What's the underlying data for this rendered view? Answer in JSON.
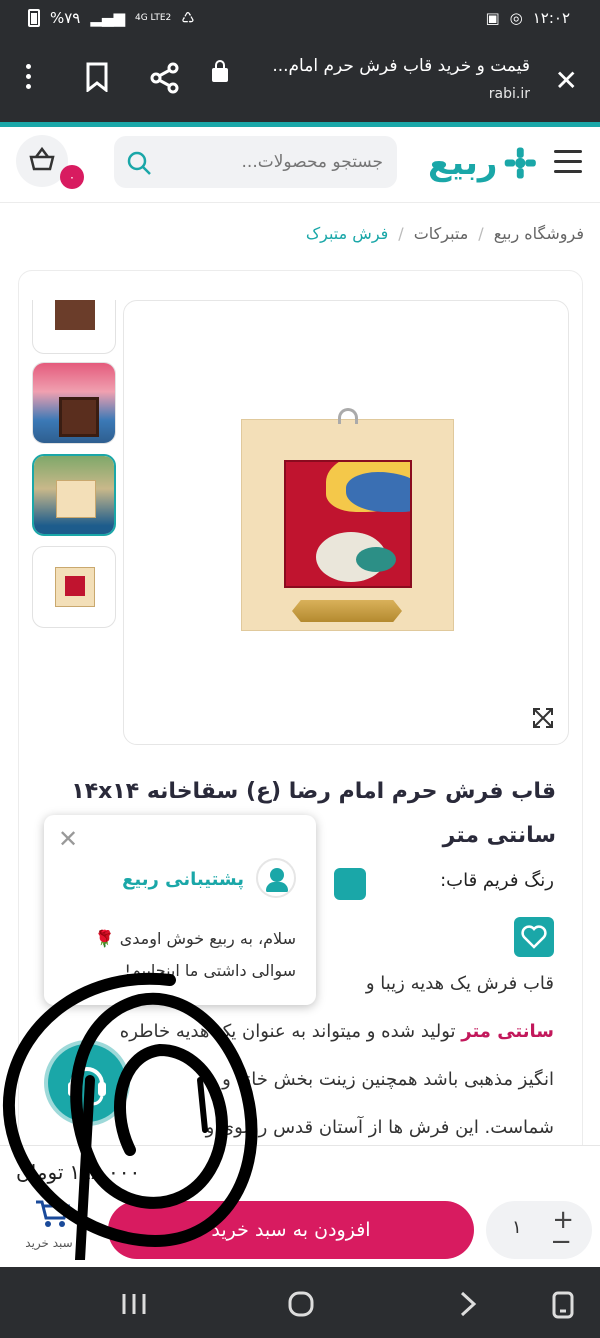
{
  "status": {
    "battery": "%۷۹",
    "network": "4G LTE2",
    "time": "۱۲:۰۲"
  },
  "browser": {
    "title": "قیمت و خرید قاب فرش حرم امام...",
    "url": "rabi.ir"
  },
  "site": {
    "search_placeholder": "جستجو محصولات...",
    "cart_count": "۰"
  },
  "breadcrumb": [
    {
      "label": "فروشگاه ربیع"
    },
    {
      "label": "متبرکات"
    },
    {
      "label": "فرش متبرک"
    }
  ],
  "product": {
    "title": "قاب فرش حرم امام رضا (ع) سقاخانه ۱۴x۱۴ سانتی متر",
    "frame_color_label": "رنگ فریم قاب:",
    "desc_line1": "قاب فرش یک هدیه زیبا و",
    "desc_line2_hl": "سانتی متر",
    "desc_line2": " تولید شده و میتواند به عنوان یک هدیه خاطره",
    "desc_line3": "انگیز مذهبی باشد همچنین زینت بخش خانه و",
    "desc_line4": "شماست. این فرش ها از آستان قدس رضوی و",
    "price": "۱۹۸,۰۰۰",
    "currency": "تومان",
    "add_to_cart": "افزودن به سبد خرید",
    "quantity": "۱",
    "cart_label": "سبد خرید"
  },
  "chat": {
    "agent_name": "پشتیبانی ربیع",
    "message": "سلام، به ربیع خوش اومدی 🌹 سوالی داشتی ما اینجاییم!"
  },
  "colors": {
    "accent": "#1aa7a8",
    "brand_pink": "#d81b60"
  }
}
